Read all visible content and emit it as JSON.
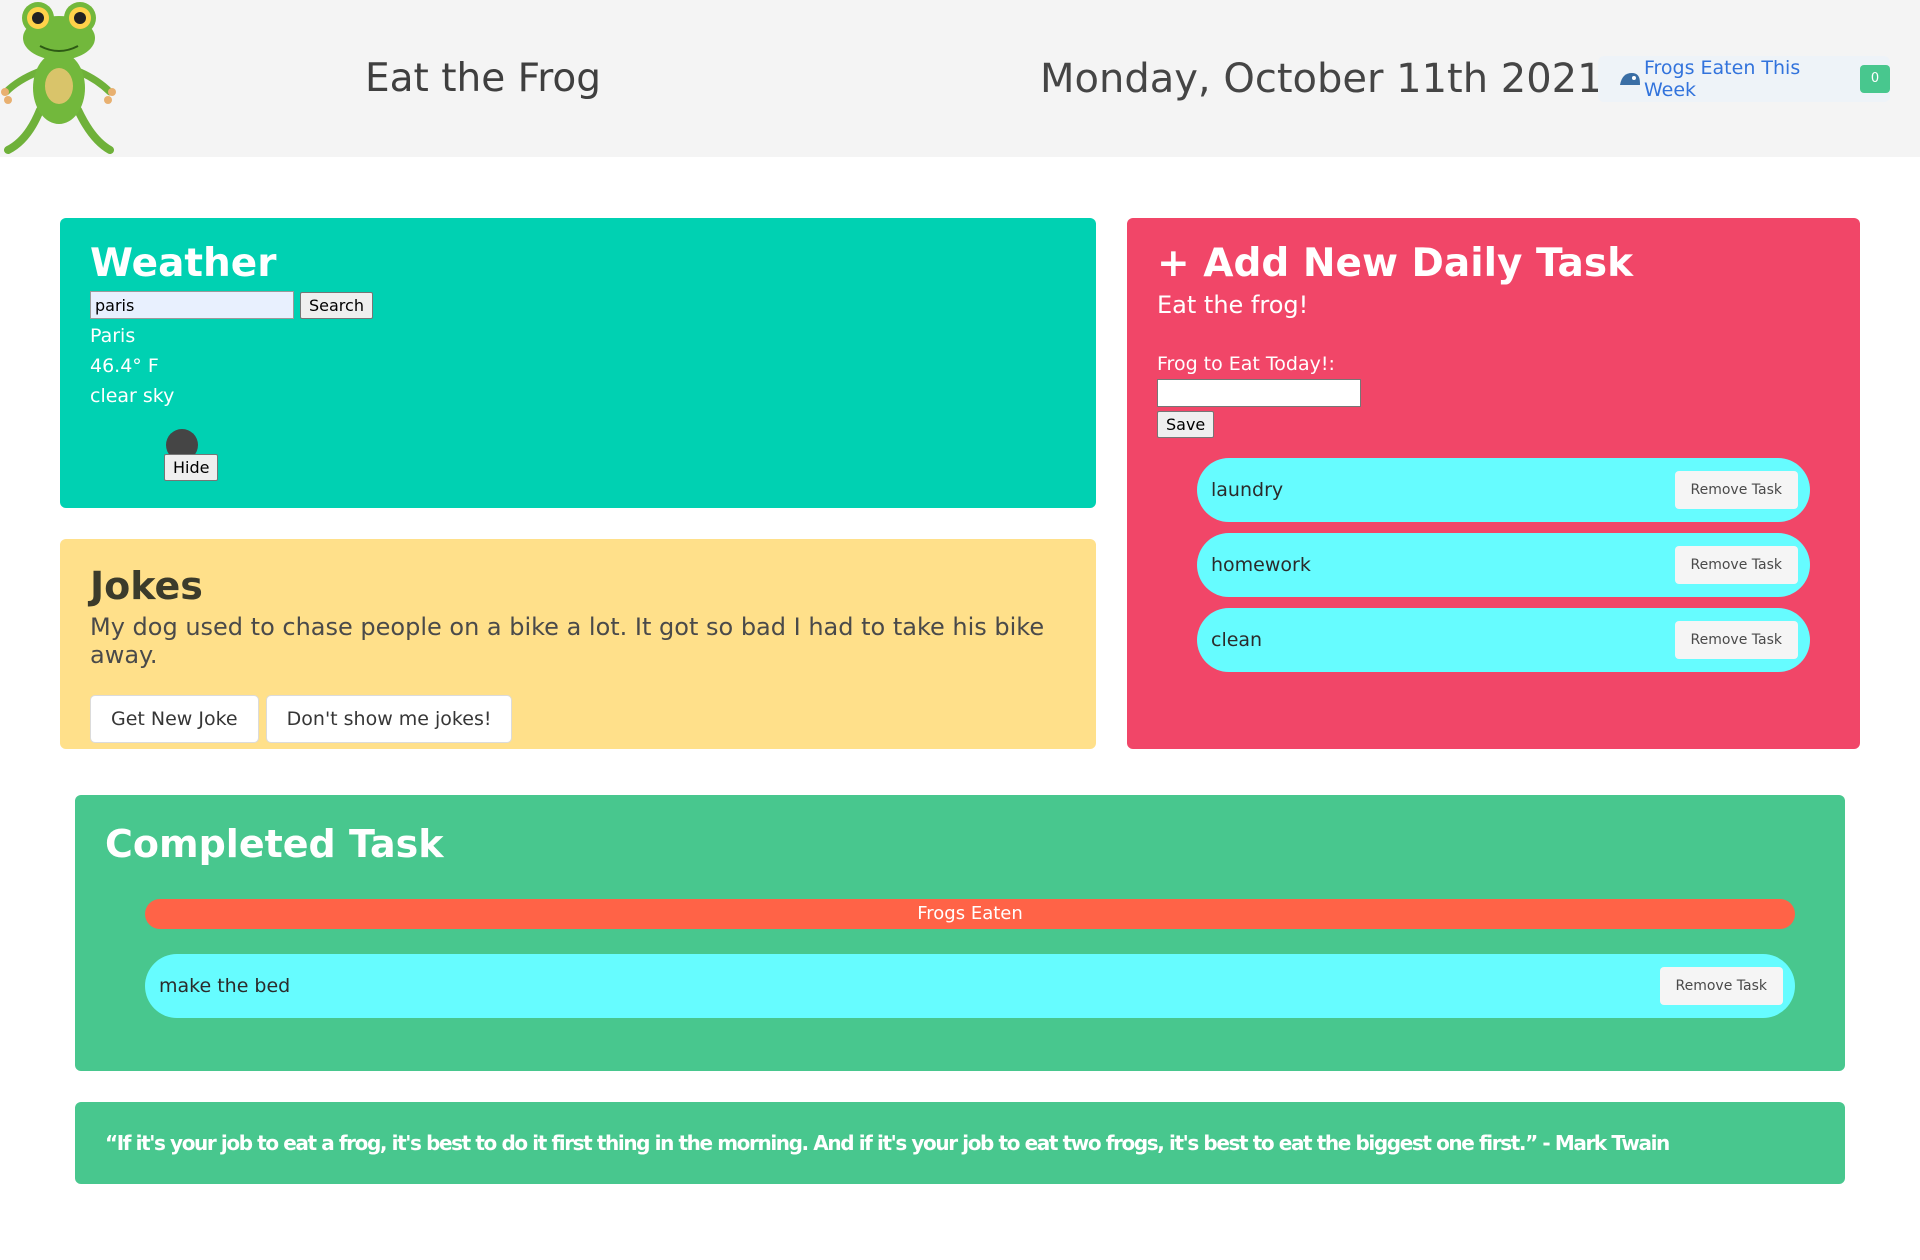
{
  "header": {
    "app_title": "Eat the Frog",
    "date": "Monday, October 11th 2021",
    "frogs_eaten_label": "Frogs Eaten This Week",
    "frogs_eaten_count": "0"
  },
  "weather": {
    "title": "Weather",
    "search_value": "paris",
    "search_button": "Search",
    "city": "Paris",
    "temperature": "46.4° F",
    "description": "clear sky",
    "hide_button": "Hide"
  },
  "jokes": {
    "title": "Jokes",
    "joke_text": "My dog used to chase people on a bike a lot. It got so bad I had to take his bike away.",
    "new_joke_button": "Get New Joke",
    "hide_jokes_button": "Don't show me jokes!"
  },
  "daily_task": {
    "title": "+ Add New Daily Task",
    "subtitle": "Eat the frog!",
    "input_label": "Frog to Eat Today!:",
    "save_button": "Save",
    "tasks": [
      {
        "label": "laundry",
        "remove": "Remove Task"
      },
      {
        "label": "homework",
        "remove": "Remove Task"
      },
      {
        "label": "clean",
        "remove": "Remove Task"
      }
    ]
  },
  "completed": {
    "title": "Completed Task",
    "progress_label": "Frogs Eaten",
    "tasks": [
      {
        "label": "make the bed",
        "remove": "Remove Task"
      }
    ]
  },
  "quote": {
    "text": "“If it's your job to eat a frog, it's best to do it first thing in the morning. And if it's your job to eat two frogs, it's best to eat the biggest one first.” - Mark Twain"
  },
  "colors": {
    "weather_bg": "#00d1b2",
    "jokes_bg": "#ffe08a",
    "task_bg": "#f14668",
    "completed_bg": "#48c78e",
    "pill_bg": "#66fcff",
    "progress_bg": "#ff6347"
  }
}
